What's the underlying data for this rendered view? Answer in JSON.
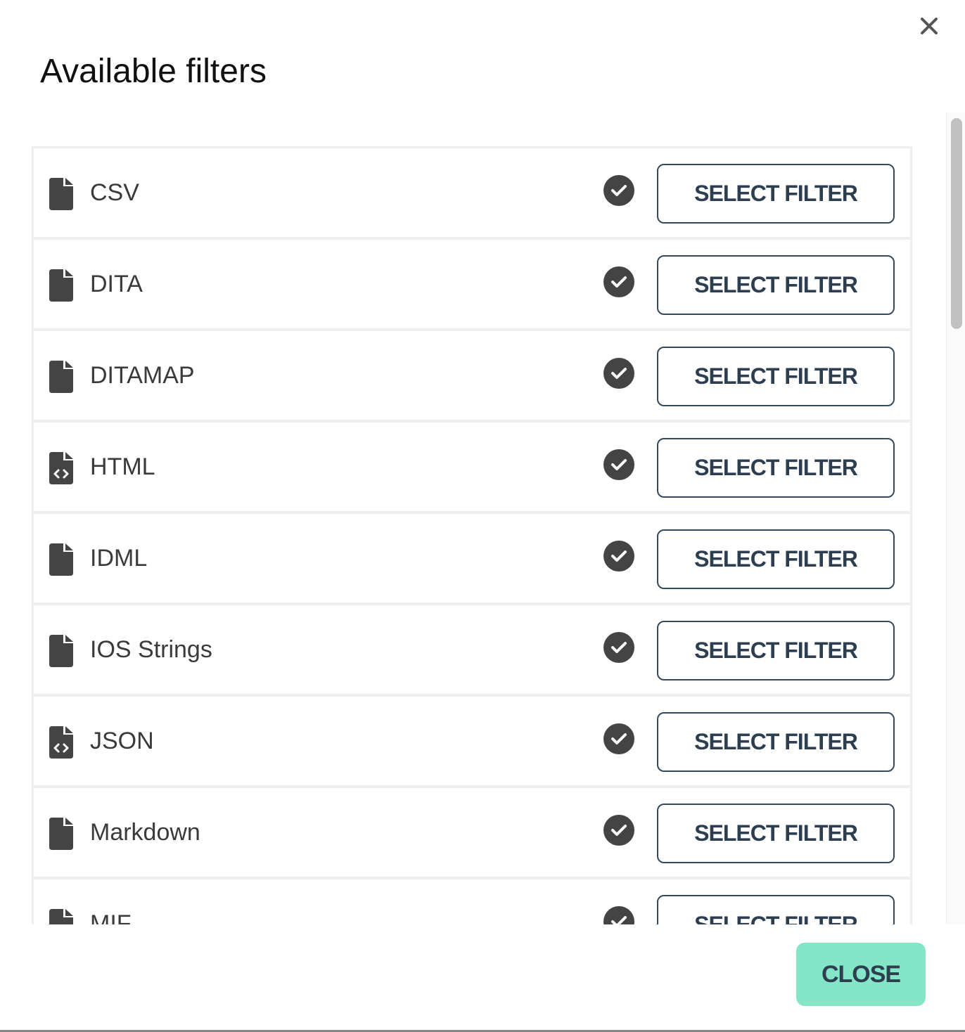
{
  "dialog": {
    "title": "Available filters",
    "close_icon": "close-x-icon",
    "close_button_label": "CLOSE",
    "accent_color": "#84e6c6",
    "button_text_color": "#2c3e50"
  },
  "filters": [
    {
      "name": "CSV",
      "icon": "file-icon",
      "button_label": "SELECT FILTER",
      "available": true
    },
    {
      "name": "DITA",
      "icon": "file-icon",
      "button_label": "SELECT FILTER",
      "available": true
    },
    {
      "name": "DITAMAP",
      "icon": "file-icon",
      "button_label": "SELECT FILTER",
      "available": true
    },
    {
      "name": "HTML",
      "icon": "file-code-icon",
      "button_label": "SELECT FILTER",
      "available": true
    },
    {
      "name": "IDML",
      "icon": "file-icon",
      "button_label": "SELECT FILTER",
      "available": true
    },
    {
      "name": "IOS Strings",
      "icon": "file-icon",
      "button_label": "SELECT FILTER",
      "available": true
    },
    {
      "name": "JSON",
      "icon": "file-code-icon",
      "button_label": "SELECT FILTER",
      "available": true
    },
    {
      "name": "Markdown",
      "icon": "file-icon",
      "button_label": "SELECT FILTER",
      "available": true
    },
    {
      "name": "MIF",
      "icon": "file-icon",
      "button_label": "SELECT FILTER",
      "available": true
    }
  ]
}
